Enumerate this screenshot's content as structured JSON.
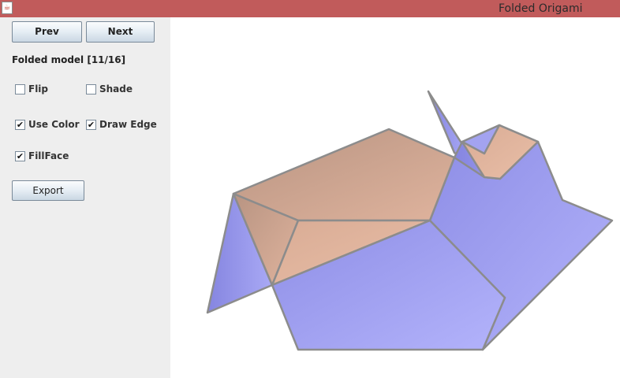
{
  "window": {
    "title": "Folded Origami",
    "icon": "java-coffee-cup-icon"
  },
  "controls": {
    "prev_label": "Prev",
    "next_label": "Next",
    "model_status": "Folded model [11/16]",
    "export_label": "Export"
  },
  "checkboxes": {
    "flip": {
      "label": "Flip",
      "checked": false
    },
    "shade": {
      "label": "Shade",
      "checked": false
    },
    "use_color": {
      "label": "Use Color",
      "checked": true
    },
    "draw_edge": {
      "label": "Draw Edge",
      "checked": true
    },
    "fill_face": {
      "label": "FillFace",
      "checked": true
    }
  },
  "colors": {
    "front_face": "#a6a6f2",
    "back_face": "#d7ad96",
    "edge": "#8c8c8c",
    "titlebar": "#c15b5b"
  }
}
